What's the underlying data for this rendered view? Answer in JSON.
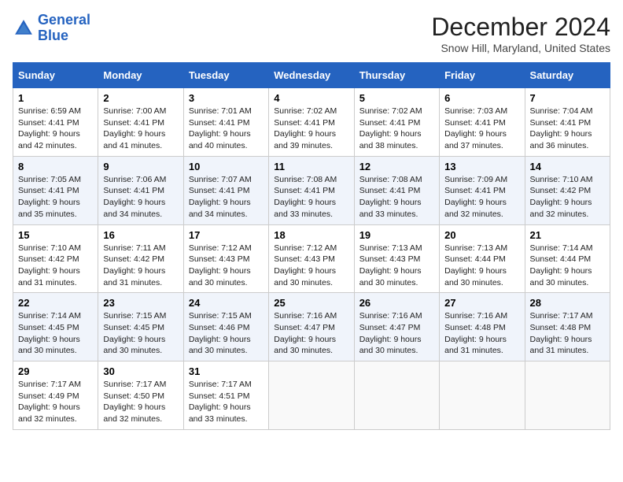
{
  "header": {
    "logo_line1": "General",
    "logo_line2": "Blue",
    "month_title": "December 2024",
    "location": "Snow Hill, Maryland, United States"
  },
  "weekdays": [
    "Sunday",
    "Monday",
    "Tuesday",
    "Wednesday",
    "Thursday",
    "Friday",
    "Saturday"
  ],
  "weeks": [
    [
      {
        "day": "1",
        "sunrise": "6:59 AM",
        "sunset": "4:41 PM",
        "daylight": "9 hours and 42 minutes."
      },
      {
        "day": "2",
        "sunrise": "7:00 AM",
        "sunset": "4:41 PM",
        "daylight": "9 hours and 41 minutes."
      },
      {
        "day": "3",
        "sunrise": "7:01 AM",
        "sunset": "4:41 PM",
        "daylight": "9 hours and 40 minutes."
      },
      {
        "day": "4",
        "sunrise": "7:02 AM",
        "sunset": "4:41 PM",
        "daylight": "9 hours and 39 minutes."
      },
      {
        "day": "5",
        "sunrise": "7:02 AM",
        "sunset": "4:41 PM",
        "daylight": "9 hours and 38 minutes."
      },
      {
        "day": "6",
        "sunrise": "7:03 AM",
        "sunset": "4:41 PM",
        "daylight": "9 hours and 37 minutes."
      },
      {
        "day": "7",
        "sunrise": "7:04 AM",
        "sunset": "4:41 PM",
        "daylight": "9 hours and 36 minutes."
      }
    ],
    [
      {
        "day": "8",
        "sunrise": "7:05 AM",
        "sunset": "4:41 PM",
        "daylight": "9 hours and 35 minutes."
      },
      {
        "day": "9",
        "sunrise": "7:06 AM",
        "sunset": "4:41 PM",
        "daylight": "9 hours and 34 minutes."
      },
      {
        "day": "10",
        "sunrise": "7:07 AM",
        "sunset": "4:41 PM",
        "daylight": "9 hours and 34 minutes."
      },
      {
        "day": "11",
        "sunrise": "7:08 AM",
        "sunset": "4:41 PM",
        "daylight": "9 hours and 33 minutes."
      },
      {
        "day": "12",
        "sunrise": "7:08 AM",
        "sunset": "4:41 PM",
        "daylight": "9 hours and 33 minutes."
      },
      {
        "day": "13",
        "sunrise": "7:09 AM",
        "sunset": "4:41 PM",
        "daylight": "9 hours and 32 minutes."
      },
      {
        "day": "14",
        "sunrise": "7:10 AM",
        "sunset": "4:42 PM",
        "daylight": "9 hours and 32 minutes."
      }
    ],
    [
      {
        "day": "15",
        "sunrise": "7:10 AM",
        "sunset": "4:42 PM",
        "daylight": "9 hours and 31 minutes."
      },
      {
        "day": "16",
        "sunrise": "7:11 AM",
        "sunset": "4:42 PM",
        "daylight": "9 hours and 31 minutes."
      },
      {
        "day": "17",
        "sunrise": "7:12 AM",
        "sunset": "4:43 PM",
        "daylight": "9 hours and 30 minutes."
      },
      {
        "day": "18",
        "sunrise": "7:12 AM",
        "sunset": "4:43 PM",
        "daylight": "9 hours and 30 minutes."
      },
      {
        "day": "19",
        "sunrise": "7:13 AM",
        "sunset": "4:43 PM",
        "daylight": "9 hours and 30 minutes."
      },
      {
        "day": "20",
        "sunrise": "7:13 AM",
        "sunset": "4:44 PM",
        "daylight": "9 hours and 30 minutes."
      },
      {
        "day": "21",
        "sunrise": "7:14 AM",
        "sunset": "4:44 PM",
        "daylight": "9 hours and 30 minutes."
      }
    ],
    [
      {
        "day": "22",
        "sunrise": "7:14 AM",
        "sunset": "4:45 PM",
        "daylight": "9 hours and 30 minutes."
      },
      {
        "day": "23",
        "sunrise": "7:15 AM",
        "sunset": "4:45 PM",
        "daylight": "9 hours and 30 minutes."
      },
      {
        "day": "24",
        "sunrise": "7:15 AM",
        "sunset": "4:46 PM",
        "daylight": "9 hours and 30 minutes."
      },
      {
        "day": "25",
        "sunrise": "7:16 AM",
        "sunset": "4:47 PM",
        "daylight": "9 hours and 30 minutes."
      },
      {
        "day": "26",
        "sunrise": "7:16 AM",
        "sunset": "4:47 PM",
        "daylight": "9 hours and 30 minutes."
      },
      {
        "day": "27",
        "sunrise": "7:16 AM",
        "sunset": "4:48 PM",
        "daylight": "9 hours and 31 minutes."
      },
      {
        "day": "28",
        "sunrise": "7:17 AM",
        "sunset": "4:48 PM",
        "daylight": "9 hours and 31 minutes."
      }
    ],
    [
      {
        "day": "29",
        "sunrise": "7:17 AM",
        "sunset": "4:49 PM",
        "daylight": "9 hours and 32 minutes."
      },
      {
        "day": "30",
        "sunrise": "7:17 AM",
        "sunset": "4:50 PM",
        "daylight": "9 hours and 32 minutes."
      },
      {
        "day": "31",
        "sunrise": "7:17 AM",
        "sunset": "4:51 PM",
        "daylight": "9 hours and 33 minutes."
      },
      null,
      null,
      null,
      null
    ]
  ]
}
